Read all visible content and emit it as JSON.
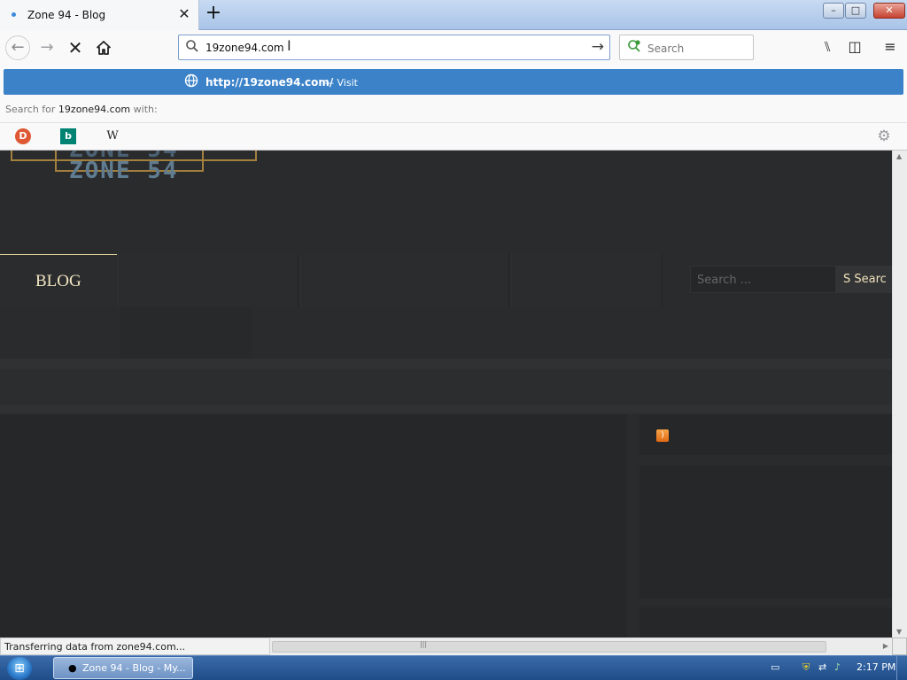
{
  "tab": {
    "title": "Zone 94 - Blog",
    "close_glyph": "✕",
    "new_tab_glyph": "+"
  },
  "window_controls": {
    "minimize": "–",
    "maximize": "□",
    "close": "✕"
  },
  "toolbar": {
    "back_glyph": "←",
    "forward_glyph": "→",
    "stop_glyph": "✕",
    "home_glyph": "⌂",
    "url_value": "19zone94.com",
    "go_glyph": "→",
    "search_placeholder": "Search",
    "library_glyph": "⑊",
    "sidebar_glyph": "◫",
    "menu_glyph": "≡"
  },
  "dropdown": {
    "suggest_url": "http://19zone94.com/",
    "suggest_action": "— Visit",
    "search_for_prefix": "Search for",
    "search_for_term": "19zone94.com",
    "search_for_suffix": "with:",
    "engines": {
      "ddg": "D",
      "bing": "b",
      "wiki": "W",
      "settings": "⚙"
    }
  },
  "page": {
    "logo_text": "ZONE 54",
    "nav_blog": "BLOG",
    "search_placeholder": "Search ...",
    "search_button": "S  Searc",
    "rss_glyph": ")"
  },
  "status": {
    "text": "Transferring data from zone94.com..."
  },
  "taskbar": {
    "start_glyph": "⊞",
    "task_label": "Zone 94 - Blog - My...",
    "clock": "2:17 PM"
  }
}
